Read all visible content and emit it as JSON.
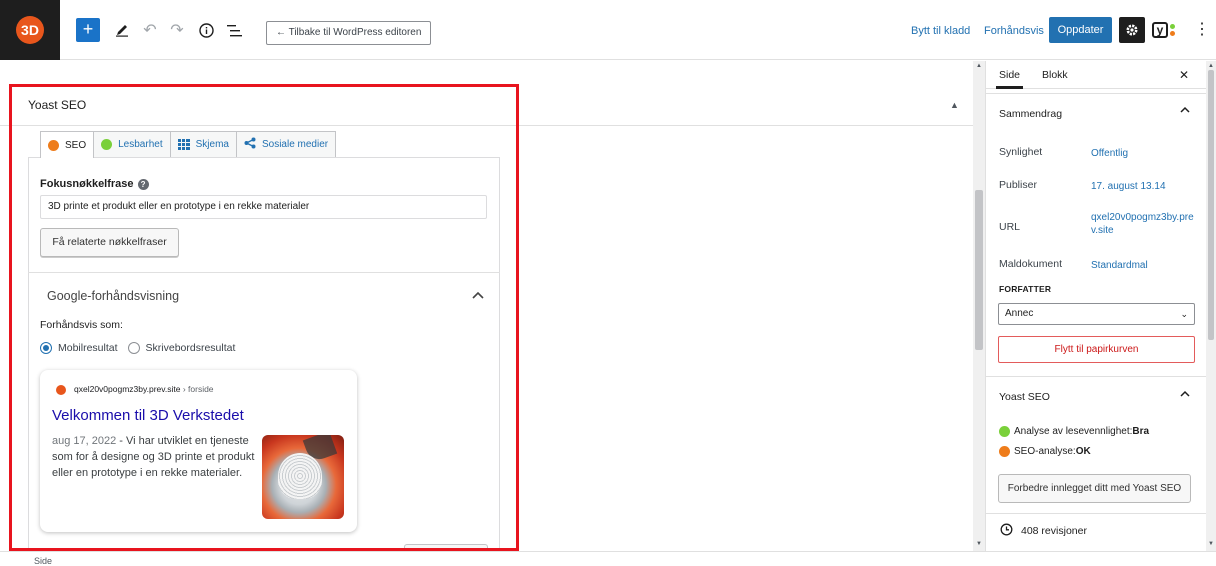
{
  "toolbar": {
    "logo_text": "3D",
    "add_symbol": "+",
    "back_button": "← Tilbake til WordPress editoren",
    "switch_draft": "Bytt til kladd",
    "preview": "Forhåndsvis",
    "update": "Oppdater",
    "yoast_glyph": "y"
  },
  "main": {
    "yoast_title": "Yoast SEO",
    "tabs": [
      {
        "label": "SEO",
        "icon": "orange-face-icon"
      },
      {
        "label": "Lesbarhet",
        "icon": "green-face-icon"
      },
      {
        "label": "Skjema",
        "icon": "grid-icon"
      },
      {
        "label": "Sosiale medier",
        "icon": "share-icon"
      }
    ],
    "focus_keyphrase_label": "Fokusnøkkelfrase",
    "focus_keyphrase_value": "3D printe et produkt eller en prototype i en rekke materialer",
    "related_button": "Få relaterte nøkkelfraser",
    "google_preview_title": "Google-forhåndsvisning",
    "preview_as_label": "Forhåndsvis som:",
    "radio_mobile": "Mobilresultat",
    "radio_desktop": "Skrivebordsresultat",
    "serp": {
      "url": "qxel20v0pogmz3by.prev.site",
      "crumb": " › forside",
      "title": "Velkommen til 3D Verkstedet",
      "date": "aug 17, 2022",
      "description": " - Vi har utviklet en tjeneste som for å designe og 3D printe et produkt eller en prototype i en rekke materialer."
    },
    "bottom_label": "Side"
  },
  "sidebar": {
    "tab_page": "Side",
    "tab_block": "Blokk",
    "summary_title": "Sammendrag",
    "rows": [
      {
        "label": "Synlighet",
        "value": "Offentlig"
      },
      {
        "label": "Publiser",
        "value": "17. august 13.14"
      },
      {
        "label": "URL",
        "value": "qxel20v0pogmz3by.prev.site"
      },
      {
        "label": "Maldokument",
        "value": "Standardmal"
      }
    ],
    "author_label": "FORFATTER",
    "author_value": "Annec",
    "trash_button": "Flytt til papirkurven",
    "yoast_title": "Yoast SEO",
    "readability_label": "Analyse av lesevennlighet: ",
    "readability_value": "Bra",
    "seo_label": "SEO-analyse: ",
    "seo_value": "OK",
    "improve_button": "Forbedre innlegget ditt med Yoast SEO",
    "revisions": "408 revisjoner"
  },
  "colors": {
    "accent": "#2271b1",
    "highlight_outline": "#e8141e",
    "seo_face": "#ee7c1b",
    "readability_face": "#7ad03a"
  }
}
